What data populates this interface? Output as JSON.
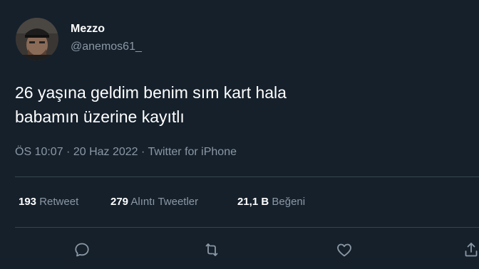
{
  "user": {
    "display_name": "Mezzo",
    "handle": "@anemos61_",
    "avatar_icon": "profile-photo"
  },
  "tweet": {
    "text_lines": [
      "26 yaşına geldim benim sım kart hala",
      "babamın üzerine kayıtlı"
    ]
  },
  "meta": {
    "time": "ÖS 10:07",
    "separator": " · ",
    "date": "20 Haz 2022",
    "source": "Twitter for iPhone"
  },
  "stats": {
    "retweets": {
      "count": "193",
      "label": "Retweet"
    },
    "quotes": {
      "count": "279",
      "label": "Alıntı Tweetler"
    },
    "likes": {
      "count": "21,1 B",
      "label": "Beğeni"
    }
  },
  "actions": {
    "reply_icon": "reply-icon",
    "retweet_icon": "retweet-icon",
    "like_icon": "heart-icon",
    "share_icon": "share-icon"
  },
  "colors": {
    "background": "#15202b",
    "primary_text": "#ffffff",
    "secondary_text": "#8b98a5",
    "divider": "#38444d"
  }
}
